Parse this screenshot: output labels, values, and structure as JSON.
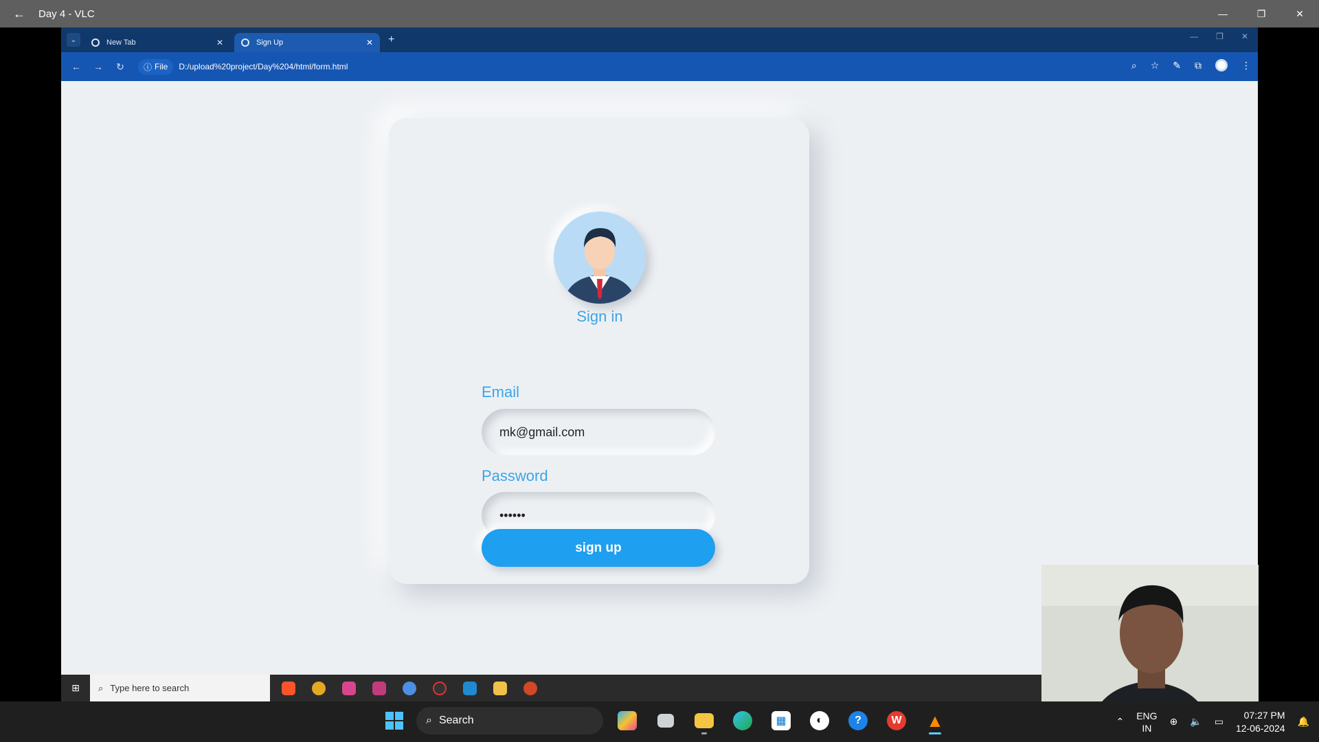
{
  "vlc": {
    "title": "Day 4 - VLC",
    "back_icon": "←",
    "minimize_icon": "—",
    "restore_icon": "❐",
    "close_icon": "✕"
  },
  "browser": {
    "tabs": [
      {
        "label": "New Tab",
        "active": false
      },
      {
        "label": "Sign Up",
        "active": true
      }
    ],
    "new_tab_icon": "+",
    "back_icon": "←",
    "forward_icon": "→",
    "reload_icon": "↻",
    "site_info_label": "File",
    "url": "D:/upload%20project/Day%204/html/form.html"
  },
  "form": {
    "title": "Sign in",
    "email_label": "Email",
    "email_value": "mk@gmail.com",
    "password_label": "Password",
    "password_value": "••••••",
    "submit_label": "sign up",
    "accent_color": "#1e9ff0"
  },
  "inner_taskbar": {
    "search_placeholder": "Type here to search"
  },
  "taskbar": {
    "search_label": "Search",
    "lang_line1": "ENG",
    "lang_line2": "IN",
    "time": "07:27 PM",
    "date": "12-06-2024"
  }
}
